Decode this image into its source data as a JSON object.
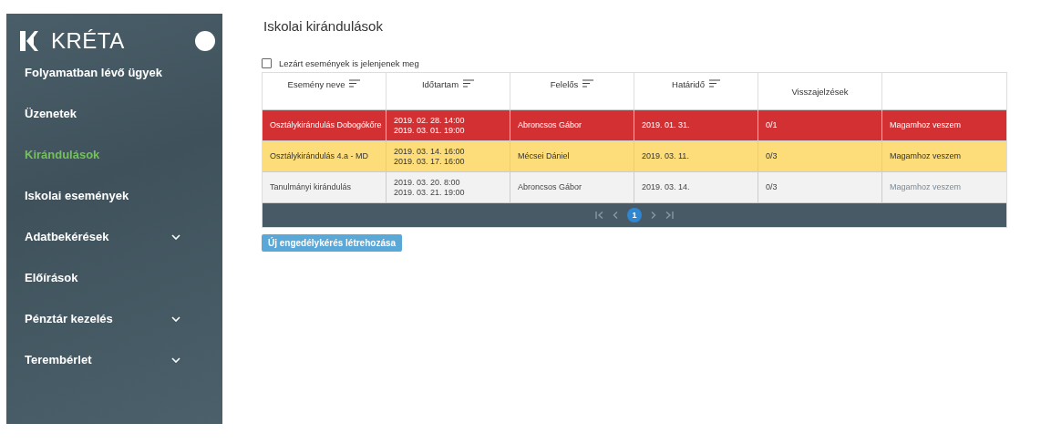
{
  "sidebar": {
    "logo": "KRÉTA",
    "items": [
      {
        "label": "Folyamatban lévő ügyek",
        "selected": false,
        "expandable": false
      },
      {
        "label": "Üzenetek",
        "selected": false,
        "expandable": false
      },
      {
        "label": "Kirándulások",
        "selected": true,
        "expandable": false
      },
      {
        "label": "Iskolai események",
        "selected": false,
        "expandable": false
      },
      {
        "label": "Adatbekérések",
        "selected": false,
        "expandable": true
      },
      {
        "label": "Előírások",
        "selected": false,
        "expandable": false
      },
      {
        "label": "Pénztár kezelés",
        "selected": false,
        "expandable": true
      },
      {
        "label": "Terembérlet",
        "selected": false,
        "expandable": true
      }
    ]
  },
  "page_title": "Iskolai kirándulások",
  "filter": {
    "label": "Lezárt események is jelenjenek meg",
    "checked": false
  },
  "table": {
    "columns": [
      {
        "label": "Esemény neve",
        "sortable": true
      },
      {
        "label": "Időtartam",
        "sortable": true
      },
      {
        "label": "Felelős",
        "sortable": true
      },
      {
        "label": "Határidő",
        "sortable": true
      },
      {
        "label": "Visszajelzések",
        "sortable": false
      },
      {
        "sortable": false
      }
    ],
    "rows": [
      {
        "kind": "overdue",
        "name": "Osztálykirándulás Dobogókőre",
        "start": "2019. 02. 28. 14:00",
        "end": "2019. 03. 01. 19:00",
        "owner": "Abroncsos Gábor",
        "deadline": "2019. 01. 31.",
        "feedback": "0/1",
        "action": "Magamhoz veszem"
      },
      {
        "kind": "warning",
        "name": "Osztálykirándulás 4.a - MD",
        "start": "2019. 03. 14. 16:00",
        "end": "2019. 03. 17. 16:00",
        "owner": "Mécsei Dániel",
        "deadline": "2019. 03. 11.",
        "feedback": "0/3",
        "action": "Magamhoz veszem"
      },
      {
        "kind": "normal",
        "name": "Tanulmányi kirándulás",
        "start": "2019. 03. 20. 8:00",
        "end": "2019. 03. 21. 19:00",
        "owner": "Abroncsos Gábor",
        "deadline": "2019. 03. 14.",
        "feedback": "0/3",
        "action": "Magamhoz veszem"
      }
    ],
    "pager": {
      "pages": [
        {
          "label": "1",
          "selected": true
        }
      ]
    }
  },
  "create_button": "Új engedélykérés létrehozása"
}
